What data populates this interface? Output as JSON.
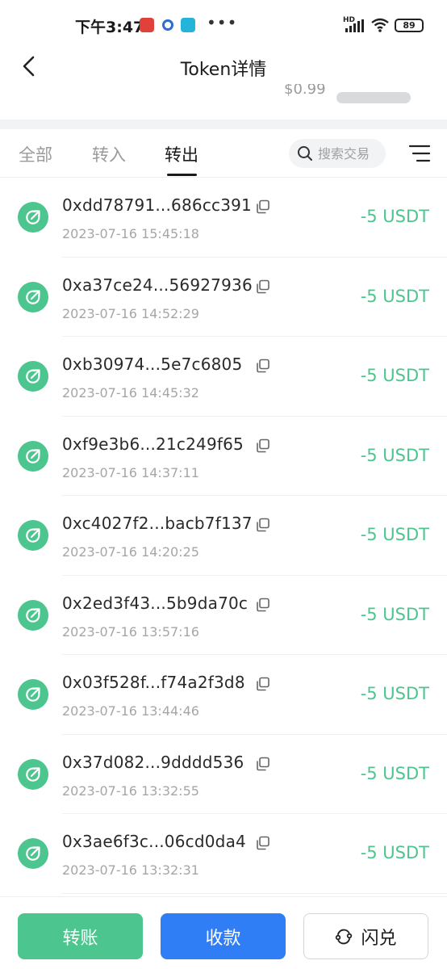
{
  "status_bar": {
    "time": "下午3:47",
    "network": "HD",
    "battery": "89"
  },
  "header": {
    "title": "Token详情"
  },
  "balance": {
    "value": "$0.99"
  },
  "tabs": [
    {
      "label": "全部",
      "active": false
    },
    {
      "label": "转入",
      "active": false
    },
    {
      "label": "转出",
      "active": true
    }
  ],
  "search": {
    "placeholder": "搜索交易"
  },
  "accent_colors": {
    "green": "#4cc58f",
    "blue": "#2f7ef6"
  },
  "transactions": [
    {
      "hash": "0xdd78791...686cc391",
      "time": "2023-07-16 15:45:18",
      "amount": "-5 USDT"
    },
    {
      "hash": "0xa37ce24...56927936",
      "time": "2023-07-16 14:52:29",
      "amount": "-5 USDT"
    },
    {
      "hash": "0xb30974...5e7c6805",
      "time": "2023-07-16 14:45:32",
      "amount": "-5 USDT"
    },
    {
      "hash": "0xf9e3b6...21c249f65",
      "time": "2023-07-16 14:37:11",
      "amount": "-5 USDT"
    },
    {
      "hash": "0xc4027f2...bacb7f137",
      "time": "2023-07-16 14:20:25",
      "amount": "-5 USDT"
    },
    {
      "hash": "0x2ed3f43...5b9da70c",
      "time": "2023-07-16 13:57:16",
      "amount": "-5 USDT"
    },
    {
      "hash": "0x03f528f...f74a2f3d8",
      "time": "2023-07-16 13:44:46",
      "amount": "-5 USDT"
    },
    {
      "hash": "0x37d082...9dddd536",
      "time": "2023-07-16 13:32:55",
      "amount": "-5 USDT"
    },
    {
      "hash": "0x3ae6f3c...06cd0da4",
      "time": "2023-07-16 13:32:31",
      "amount": "-5 USDT"
    }
  ],
  "actions": {
    "transfer": "转账",
    "receive": "收款",
    "swap": "闪兑"
  }
}
